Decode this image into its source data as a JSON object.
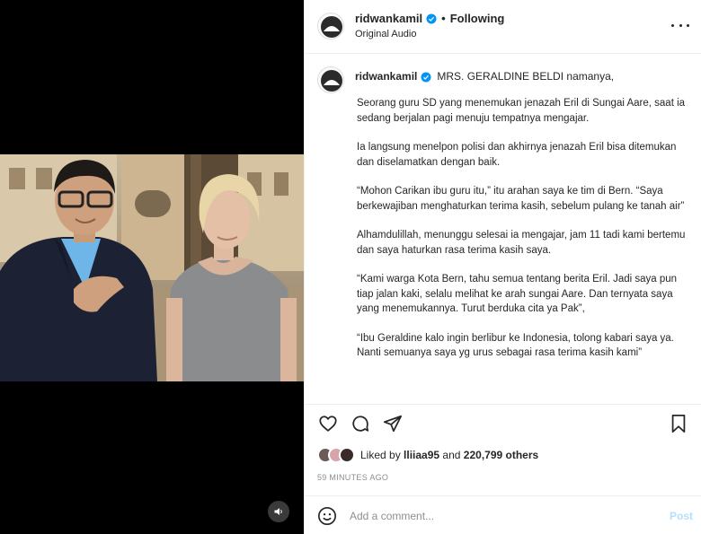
{
  "post": {
    "username": "ridwankamil",
    "follow_status": "Following",
    "audio_label": "Original Audio",
    "verified_icon": "verified-badge-icon"
  },
  "caption": {
    "first_line": "MRS. GERALDINE BELDI namanya,",
    "paragraphs": [
      "Seorang guru SD yang menemukan jenazah Eril di Sungai Aare, saat ia sedang berjalan pagi menuju tempatnya mengajar.",
      "Ia langsung menelpon polisi dan akhirnya jenazah Eril bisa ditemukan dan diselamatkan dengan baik.",
      "“Mohon Carikan ibu guru itu,” itu arahan saya ke tim di Bern. “Saya berkewajiban menghaturkan terima kasih, sebelum pulang ke tanah air”",
      "Alhamdulillah, menunggu selesai ia mengajar, jam 11 tadi kami bertemu dan saya haturkan rasa terima kasih saya.",
      "“Kami warga Kota Bern, tahu semua tentang berita Eril. Jadi saya pun tiap jalan kaki, selalu melihat ke arah sungai Aare. Dan ternyata saya yang menemukannya. Turut berduka cita ya Pak”,",
      "“Ibu Geraldine kalo ingin berlibur ke Indonesia, tolong kabari saya ya. Nanti semuanya saya yg urus sebagai rasa terima kasih kami”"
    ]
  },
  "likes": {
    "prefix": "Liked by",
    "first_user": "lliiaa95",
    "connector": "and",
    "others": "220,799 others"
  },
  "timestamp": "59 MINUTES AGO",
  "comment": {
    "placeholder": "Add a comment...",
    "post_label": "Post"
  },
  "colors": {
    "accent": "#0095f6",
    "post_disabled": "#b2dffc",
    "muted": "#8e8e8e",
    "text": "#262626",
    "media_bg": "#000000"
  },
  "icons": [
    "heart-icon",
    "comment-icon",
    "share-icon",
    "bookmark-icon",
    "more-icon",
    "emoji-icon",
    "volume-icon"
  ]
}
